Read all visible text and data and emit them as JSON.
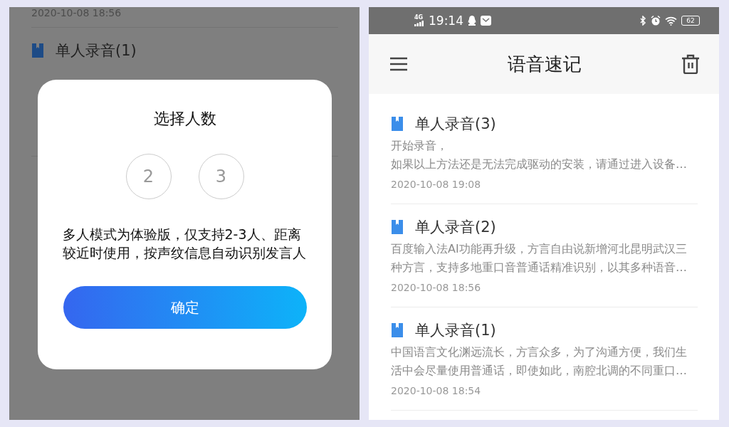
{
  "background_screen": {
    "partial_date": "2020-10-08 18:56",
    "items": [
      {
        "title": "单人录音(1)"
      }
    ]
  },
  "dialog": {
    "title": "选择人数",
    "options": [
      {
        "label": "2",
        "selected": false
      },
      {
        "label": "3",
        "selected": false
      }
    ],
    "message": "多人模式为体验版，仅支持2-3人、距离较近时使用，按声纹信息自动识别发言人",
    "confirm_button": "确定"
  },
  "status_bar": {
    "network": "4G",
    "time": "19:14",
    "battery": "62"
  },
  "app_bar": {
    "title": "语音速记"
  },
  "notes": [
    {
      "title": "单人录音(3)",
      "lines": [
        "开始录音，",
        "如果以上方法还是无法完成驱动的安装，请通过进入设备…"
      ],
      "date": "2020-10-08 19:08"
    },
    {
      "title": "单人录音(2)",
      "lines": [
        "百度输入法AI功能再升级，方言自由说新增河北昆明武汉三",
        "种方言，支持多地重口音普通话精准识别，以其多种语音…"
      ],
      "date": "2020-10-08 18:56"
    },
    {
      "title": "单人录音(1)",
      "lines": [
        "中国语言文化渊远流长，方言众多，为了沟通方便，我们生",
        "活中会尽量使用普通话，即使如此，南腔北调的不同重口…"
      ],
      "date": "2020-10-08 18:54"
    }
  ]
}
